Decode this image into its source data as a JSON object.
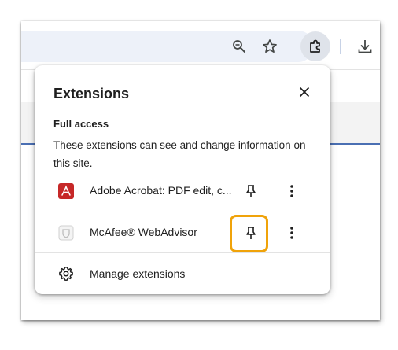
{
  "toolbar": {
    "zoom_icon": "zoom-icon",
    "bookmark_icon": "star-icon",
    "extensions_icon": "puzzle-icon",
    "download_icon": "download-icon"
  },
  "popup": {
    "title": "Extensions",
    "close_icon": "close-icon",
    "section_heading": "Full access",
    "section_description": "These extensions can see and change information on this site.",
    "extensions": [
      {
        "name": "Adobe Acrobat: PDF edit, c...",
        "icon": "adobe-acrobat-icon",
        "pin_icon": "pin-icon",
        "menu_icon": "more-vert-icon"
      },
      {
        "name": "McAfee® WebAdvisor",
        "icon": "mcafee-webadvisor-icon",
        "pin_icon": "pin-icon",
        "menu_icon": "more-vert-icon",
        "highlighted": true
      }
    ],
    "manage_label": "Manage extensions",
    "manage_icon": "gear-icon"
  },
  "colors": {
    "highlight": "#f0a30a",
    "acrobat_red": "#c62828",
    "omnibox_bg": "#edf1f9",
    "active_button_bg": "#dfe3ea"
  }
}
